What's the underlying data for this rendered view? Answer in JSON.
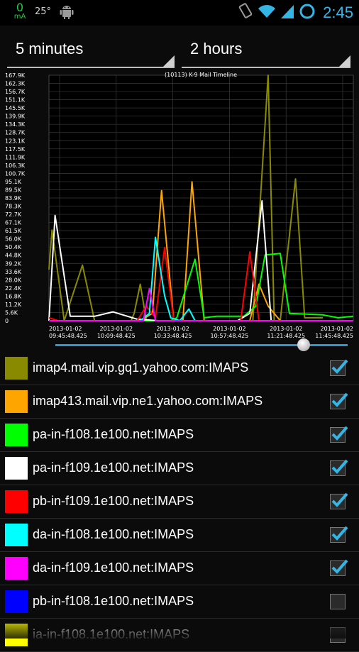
{
  "status_bar": {
    "current": "0",
    "current_unit": "mA",
    "temperature": "25°",
    "time": "2:45"
  },
  "spinners": {
    "interval": "5 minutes",
    "range": "2 hours"
  },
  "chart_data": {
    "type": "line",
    "title": "(10113) K-9 Mail Timeline",
    "y_ticks": [
      "167.9K",
      "162.3K",
      "156.7K",
      "151.1K",
      "145.5K",
      "139.9K",
      "134.3K",
      "128.7K",
      "123.1K",
      "117.5K",
      "111.9K",
      "106.3K",
      "100.7K",
      "95.1K",
      "89.5K",
      "83.9K",
      "78.3K",
      "72.7K",
      "67.1K",
      "61.5K",
      "56.0K",
      "50.4K",
      "44.8K",
      "39.2K",
      "33.6K",
      "28.0K",
      "22.4K",
      "16.8K",
      "11.2K",
      "5.6K",
      "0"
    ],
    "ylim": [
      0,
      167900
    ],
    "x_ticks": [
      {
        "date": "2013-01-02",
        "time": "09:45:48.425"
      },
      {
        "date": "2013-01-02",
        "time": "10:09:48.425"
      },
      {
        "date": "2013-01-02",
        "time": "10:33:48.425"
      },
      {
        "date": "2013-01-02",
        "time": "10:57:48.425"
      },
      {
        "date": "2013-01-02",
        "time": "11:21:48.425"
      },
      {
        "date": "2013-01-02",
        "time": "11:45:48.425"
      }
    ],
    "series": [
      {
        "name": "imap4.mail.vip.gq1.yahoo.com:IMAPS",
        "color": "#8a8a00",
        "values": [
          [
            0,
            35000
          ],
          [
            1,
            62000
          ],
          [
            5,
            0
          ],
          [
            11,
            38000
          ],
          [
            15,
            0
          ],
          [
            27,
            0
          ],
          [
            28,
            5000
          ],
          [
            30,
            25000
          ],
          [
            32,
            0
          ],
          [
            55,
            0
          ],
          [
            67,
            0
          ],
          [
            72,
            167900
          ],
          [
            74,
            0
          ],
          [
            76,
            0
          ],
          [
            81,
            97000
          ],
          [
            84,
            2000
          ],
          [
            90,
            2000
          ]
        ]
      },
      {
        "name": "imap413.mail.vip.ne1.yahoo.com:IMAPS",
        "color": "#ffa500",
        "values": [
          [
            0,
            0
          ],
          [
            30,
            0
          ],
          [
            34,
            5000
          ],
          [
            37,
            89000
          ],
          [
            41,
            0
          ],
          [
            44,
            0
          ],
          [
            47,
            95000
          ],
          [
            51,
            0
          ],
          [
            55,
            0
          ],
          [
            66,
            0
          ],
          [
            69,
            25000
          ],
          [
            72,
            10000
          ],
          [
            76,
            0
          ],
          [
            87,
            0
          ],
          [
            90,
            0
          ],
          [
            100,
            0
          ]
        ]
      },
      {
        "name": "pa-in-f108.1e100.net:IMAPS",
        "color": "#00ff00",
        "values": [
          [
            0,
            0
          ],
          [
            40,
            0
          ],
          [
            42,
            2000
          ],
          [
            48,
            42000
          ],
          [
            51,
            2000
          ],
          [
            55,
            3000
          ],
          [
            64,
            3000
          ],
          [
            68,
            10000
          ],
          [
            71,
            45000
          ],
          [
            76,
            46000
          ],
          [
            79,
            5000
          ],
          [
            90,
            4000
          ],
          [
            95,
            2000
          ],
          [
            100,
            3000
          ]
        ]
      },
      {
        "name": "pa-in-f109.1e100.net:IMAPS",
        "color": "#ffffff",
        "values": [
          [
            0,
            0
          ],
          [
            2,
            72000
          ],
          [
            7,
            3000
          ],
          [
            15,
            3000
          ],
          [
            21,
            6000
          ],
          [
            29,
            1000
          ],
          [
            36,
            0
          ],
          [
            40,
            0
          ],
          [
            62,
            0
          ],
          [
            66,
            5000
          ],
          [
            70,
            82000
          ],
          [
            73,
            0
          ],
          [
            100,
            0
          ]
        ]
      },
      {
        "name": "pb-in-f109.1e100.net:IMAPS",
        "color": "#ff0000",
        "values": [
          [
            0,
            2000
          ],
          [
            3,
            0
          ],
          [
            29,
            0
          ],
          [
            32,
            10000
          ],
          [
            35,
            2000
          ],
          [
            38,
            50000
          ],
          [
            41,
            0
          ],
          [
            63,
            0
          ],
          [
            66,
            47000
          ],
          [
            69,
            0
          ],
          [
            100,
            0
          ]
        ]
      },
      {
        "name": "da-in-f108.1e100.net:IMAPS",
        "color": "#00ffff",
        "values": [
          [
            0,
            0
          ],
          [
            30,
            0
          ],
          [
            33,
            5000
          ],
          [
            35,
            57000
          ],
          [
            38,
            17000
          ],
          [
            40,
            2000
          ],
          [
            43,
            0
          ],
          [
            46,
            8000
          ],
          [
            48,
            0
          ],
          [
            100,
            0
          ]
        ]
      },
      {
        "name": "da-in-f109.1e100.net:IMAPS",
        "color": "#ff00ff",
        "values": [
          [
            0,
            0
          ],
          [
            31,
            0
          ],
          [
            33,
            22000
          ],
          [
            35,
            0
          ],
          [
            100,
            0
          ]
        ]
      },
      {
        "name": "pb-in-f108.1e100.net:IMAPS",
        "color": "#0000ff",
        "values": []
      },
      {
        "name": "ia-in-f108.1e100.net:IMAPS",
        "color": "#ffff00",
        "values": []
      }
    ]
  },
  "legend": [
    {
      "label": "imap4.mail.vip.gq1.yahoo.com:IMAPS",
      "color": "#8a8a00",
      "checked": true
    },
    {
      "label": "imap413.mail.vip.ne1.yahoo.com:IMAPS",
      "color": "#ffa500",
      "checked": true
    },
    {
      "label": "pa-in-f108.1e100.net:IMAPS",
      "color": "#00ff00",
      "checked": true
    },
    {
      "label": "pa-in-f109.1e100.net:IMAPS",
      "color": "#ffffff",
      "checked": true
    },
    {
      "label": "pb-in-f109.1e100.net:IMAPS",
      "color": "#ff0000",
      "checked": true
    },
    {
      "label": "da-in-f108.1e100.net:IMAPS",
      "color": "#00ffff",
      "checked": true
    },
    {
      "label": "da-in-f109.1e100.net:IMAPS",
      "color": "#ff00ff",
      "checked": true
    },
    {
      "label": "pb-in-f108.1e100.net:IMAPS",
      "color": "#0000ff",
      "checked": false
    },
    {
      "label": "ia-in-f108.1e100.net:IMAPS",
      "color": "#ffff00",
      "checked": false
    }
  ],
  "slider": {
    "position": 0.85
  }
}
